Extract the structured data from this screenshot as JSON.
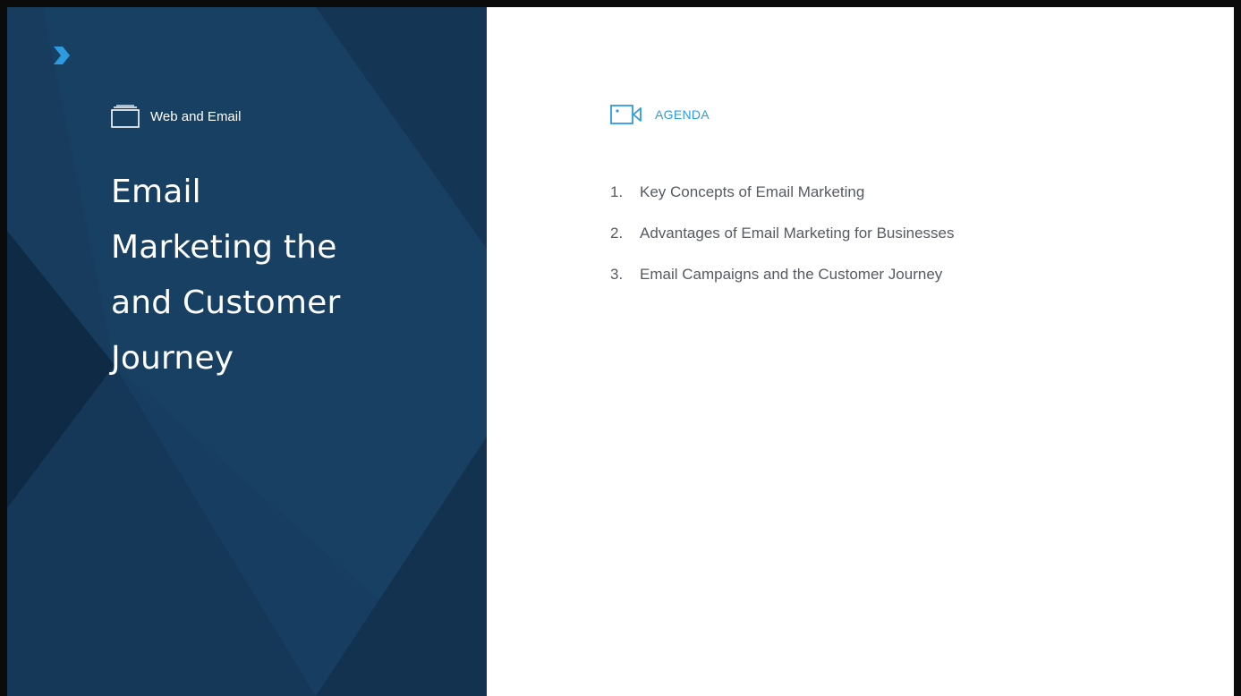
{
  "left_panel": {
    "section_label": "Web and Email",
    "title_lines": [
      "Email",
      "Marketing the",
      "and Customer",
      "Journey"
    ]
  },
  "agenda": {
    "label": "AGENDA",
    "items": [
      {
        "number": "1.",
        "text": "Key Concepts of Email Marketing"
      },
      {
        "number": "2.",
        "text": "Advantages of Email Marketing for Businesses"
      },
      {
        "number": "3.",
        "text": "Email Campaigns and the Customer Journey"
      }
    ]
  },
  "colors": {
    "panel_bg": "#173c5e",
    "accent": "#2d9be0",
    "agenda_text": "#555b61"
  },
  "icons": {
    "logo": "chevron-logo-icon",
    "section": "folder-icon",
    "agenda": "video-camera-icon"
  }
}
